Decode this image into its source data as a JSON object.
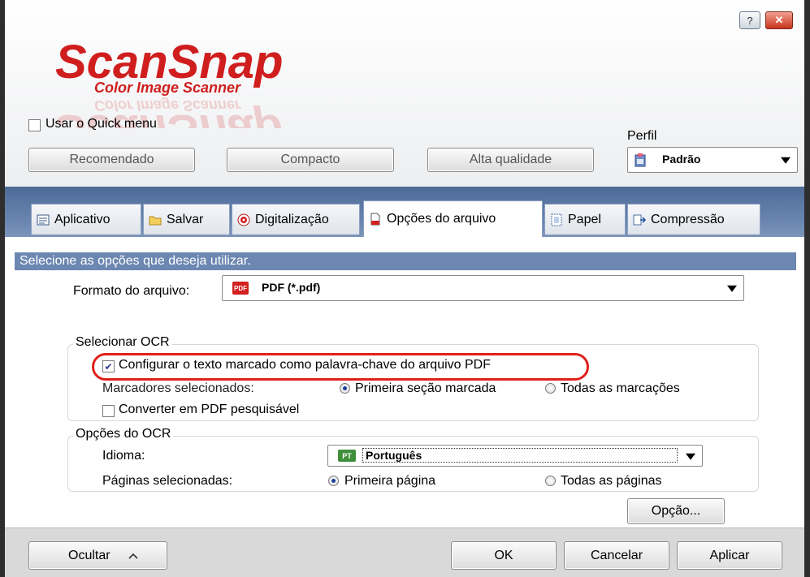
{
  "window": {
    "help_label": "?",
    "close_label": "✕"
  },
  "logo": {
    "brand": "ScanSnap",
    "tagline": "Color Image Scanner"
  },
  "quick_menu": {
    "label": "Usar o Quick menu",
    "checked": false
  },
  "profile": {
    "label": "Perfil",
    "value": "Padrão"
  },
  "presets": {
    "recommended": "Recomendado",
    "compact": "Compacto",
    "high_quality": "Alta qualidade"
  },
  "tabs": [
    "Aplicativo",
    "Salvar",
    "Digitalização",
    "Opções do arquivo",
    "Papel",
    "Compressão"
  ],
  "selected_tab": "Opções do arquivo",
  "hint": "Selecione as opções que deseja utilizar.",
  "file_format": {
    "label": "Formato do arquivo:",
    "badge": "PDF",
    "value": "PDF (*.pdf)"
  },
  "ocr_select": {
    "legend": "Selecionar OCR",
    "keyword_label": "Configurar o texto marcado como palavra-chave do arquivo PDF",
    "keyword_checked": true,
    "markers_label": "Marcadores selecionados:",
    "first_marked": "Primeira seção marcada",
    "all_marks": "Todas as marcações",
    "searchable_label": "Converter em PDF pesquisável",
    "searchable_checked": false
  },
  "ocr_options": {
    "legend": "Opções do OCR",
    "language_label": "Idioma:",
    "language_badge": "PT",
    "language_value": "Português",
    "pages_label": "Páginas selecionadas:",
    "first_page": "Primeira página",
    "all_pages": "Todas as páginas",
    "option_button": "Opção..."
  },
  "footer": {
    "hide": "Ocultar",
    "ok": "OK",
    "cancel": "Cancelar",
    "apply": "Aplicar"
  },
  "colors": {
    "brand_red": "#d01e1e",
    "tab_band": "#5c7aa6",
    "highlight_ring": "#e0201c"
  }
}
